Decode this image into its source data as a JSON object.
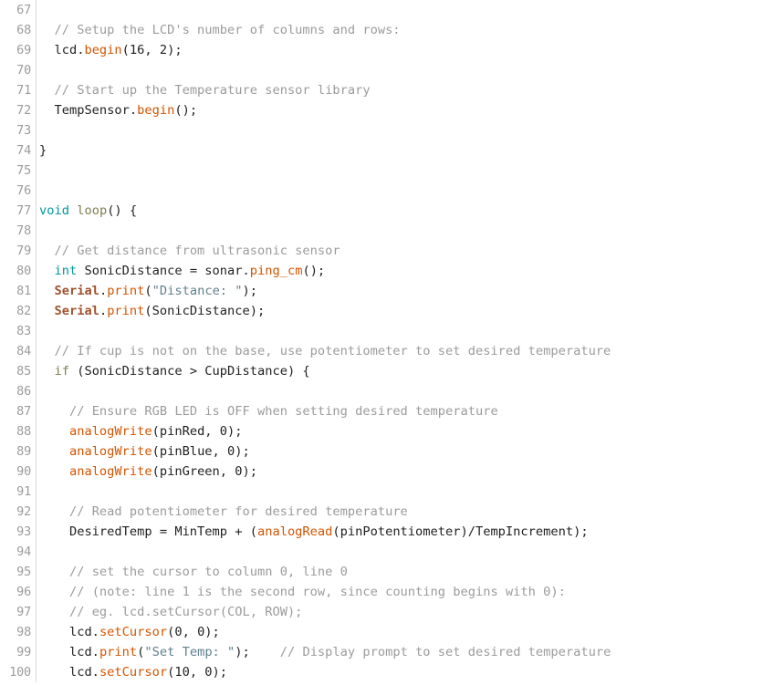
{
  "editor": {
    "kind": "code-editor",
    "language": "arduino-cpp",
    "background_color": "#ffffff",
    "gutter_color": "#9b9b9b",
    "first_line_number": 67,
    "last_line_number": 100,
    "palette": {
      "plain": "#1f1f1f",
      "comment": "#9b9b9b",
      "keyword": "#00979c",
      "structure": "#7e7d4f",
      "function": "#d35400",
      "object": "#a0522d",
      "string": "#5f7f8f"
    }
  },
  "lines": [
    {
      "number": "67",
      "tokens": []
    },
    {
      "number": "68",
      "tokens": [
        {
          "t": "  ",
          "c": "plain"
        },
        {
          "t": "// Setup the LCD's number of columns and rows:",
          "c": "comment"
        }
      ]
    },
    {
      "number": "69",
      "tokens": [
        {
          "t": "  lcd.",
          "c": "plain"
        },
        {
          "t": "begin",
          "c": "func"
        },
        {
          "t": "(16, 2);",
          "c": "plain"
        }
      ]
    },
    {
      "number": "70",
      "tokens": []
    },
    {
      "number": "71",
      "tokens": [
        {
          "t": "  ",
          "c": "plain"
        },
        {
          "t": "// Start up the Temperature sensor library",
          "c": "comment"
        }
      ]
    },
    {
      "number": "72",
      "tokens": [
        {
          "t": "  TempSensor.",
          "c": "plain"
        },
        {
          "t": "begin",
          "c": "func"
        },
        {
          "t": "();",
          "c": "plain"
        }
      ]
    },
    {
      "number": "73",
      "tokens": []
    },
    {
      "number": "74",
      "tokens": [
        {
          "t": "}",
          "c": "plain"
        }
      ]
    },
    {
      "number": "75",
      "tokens": []
    },
    {
      "number": "76",
      "tokens": []
    },
    {
      "number": "77",
      "tokens": [
        {
          "t": "void",
          "c": "keyword"
        },
        {
          "t": " ",
          "c": "plain"
        },
        {
          "t": "loop",
          "c": "struct"
        },
        {
          "t": "() {",
          "c": "plain"
        }
      ]
    },
    {
      "number": "78",
      "tokens": []
    },
    {
      "number": "79",
      "tokens": [
        {
          "t": "  ",
          "c": "plain"
        },
        {
          "t": "// Get distance from ultrasonic sensor",
          "c": "comment"
        }
      ]
    },
    {
      "number": "80",
      "tokens": [
        {
          "t": "  ",
          "c": "plain"
        },
        {
          "t": "int",
          "c": "keyword"
        },
        {
          "t": " SonicDistance = sonar.",
          "c": "plain"
        },
        {
          "t": "ping_cm",
          "c": "func"
        },
        {
          "t": "();",
          "c": "plain"
        }
      ]
    },
    {
      "number": "81",
      "tokens": [
        {
          "t": "  ",
          "c": "plain"
        },
        {
          "t": "Serial",
          "c": "object"
        },
        {
          "t": ".",
          "c": "plain"
        },
        {
          "t": "print",
          "c": "func"
        },
        {
          "t": "(",
          "c": "plain"
        },
        {
          "t": "\"Distance: \"",
          "c": "string"
        },
        {
          "t": ");",
          "c": "plain"
        }
      ]
    },
    {
      "number": "82",
      "tokens": [
        {
          "t": "  ",
          "c": "plain"
        },
        {
          "t": "Serial",
          "c": "object"
        },
        {
          "t": ".",
          "c": "plain"
        },
        {
          "t": "print",
          "c": "func"
        },
        {
          "t": "(SonicDistance);",
          "c": "plain"
        }
      ]
    },
    {
      "number": "83",
      "tokens": []
    },
    {
      "number": "84",
      "tokens": [
        {
          "t": "  ",
          "c": "plain"
        },
        {
          "t": "// If cup is not on the base, use potentiometer to set desired temperature",
          "c": "comment"
        }
      ]
    },
    {
      "number": "85",
      "tokens": [
        {
          "t": "  ",
          "c": "plain"
        },
        {
          "t": "if",
          "c": "struct"
        },
        {
          "t": " (SonicDistance > CupDistance) {",
          "c": "plain"
        }
      ]
    },
    {
      "number": "86",
      "tokens": []
    },
    {
      "number": "87",
      "tokens": [
        {
          "t": "    ",
          "c": "plain"
        },
        {
          "t": "// Ensure RGB LED is OFF when setting desired temperature",
          "c": "comment"
        }
      ]
    },
    {
      "number": "88",
      "tokens": [
        {
          "t": "    ",
          "c": "plain"
        },
        {
          "t": "analogWrite",
          "c": "func"
        },
        {
          "t": "(pinRed, 0);",
          "c": "plain"
        }
      ]
    },
    {
      "number": "89",
      "tokens": [
        {
          "t": "    ",
          "c": "plain"
        },
        {
          "t": "analogWrite",
          "c": "func"
        },
        {
          "t": "(pinBlue, 0);",
          "c": "plain"
        }
      ]
    },
    {
      "number": "90",
      "tokens": [
        {
          "t": "    ",
          "c": "plain"
        },
        {
          "t": "analogWrite",
          "c": "func"
        },
        {
          "t": "(pinGreen, 0);",
          "c": "plain"
        }
      ]
    },
    {
      "number": "91",
      "tokens": []
    },
    {
      "number": "92",
      "tokens": [
        {
          "t": "    ",
          "c": "plain"
        },
        {
          "t": "// Read potentiometer for desired temperature",
          "c": "comment"
        }
      ]
    },
    {
      "number": "93",
      "tokens": [
        {
          "t": "    DesiredTemp = MinTemp + (",
          "c": "plain"
        },
        {
          "t": "analogRead",
          "c": "func"
        },
        {
          "t": "(pinPotentiometer)/TempIncrement);",
          "c": "plain"
        }
      ]
    },
    {
      "number": "94",
      "tokens": []
    },
    {
      "number": "95",
      "tokens": [
        {
          "t": "    ",
          "c": "plain"
        },
        {
          "t": "// set the cursor to column 0, line 0",
          "c": "comment"
        }
      ]
    },
    {
      "number": "96",
      "tokens": [
        {
          "t": "    ",
          "c": "plain"
        },
        {
          "t": "// (note: line 1 is the second row, since counting begins with 0):",
          "c": "comment"
        }
      ]
    },
    {
      "number": "97",
      "tokens": [
        {
          "t": "    ",
          "c": "plain"
        },
        {
          "t": "// eg. lcd.setCursor(COL, ROW);",
          "c": "comment"
        }
      ]
    },
    {
      "number": "98",
      "tokens": [
        {
          "t": "    lcd.",
          "c": "plain"
        },
        {
          "t": "setCursor",
          "c": "func"
        },
        {
          "t": "(0, 0);",
          "c": "plain"
        }
      ]
    },
    {
      "number": "99",
      "tokens": [
        {
          "t": "    lcd.",
          "c": "plain"
        },
        {
          "t": "print",
          "c": "func"
        },
        {
          "t": "(",
          "c": "plain"
        },
        {
          "t": "\"Set Temp: \"",
          "c": "string"
        },
        {
          "t": ");",
          "c": "plain"
        },
        {
          "t": "    ",
          "c": "plain"
        },
        {
          "t": "// Display prompt to set desired temperature",
          "c": "comment"
        }
      ]
    },
    {
      "number": "100",
      "tokens": [
        {
          "t": "    lcd.",
          "c": "plain"
        },
        {
          "t": "setCursor",
          "c": "func"
        },
        {
          "t": "(10, 0);",
          "c": "plain"
        }
      ]
    }
  ]
}
